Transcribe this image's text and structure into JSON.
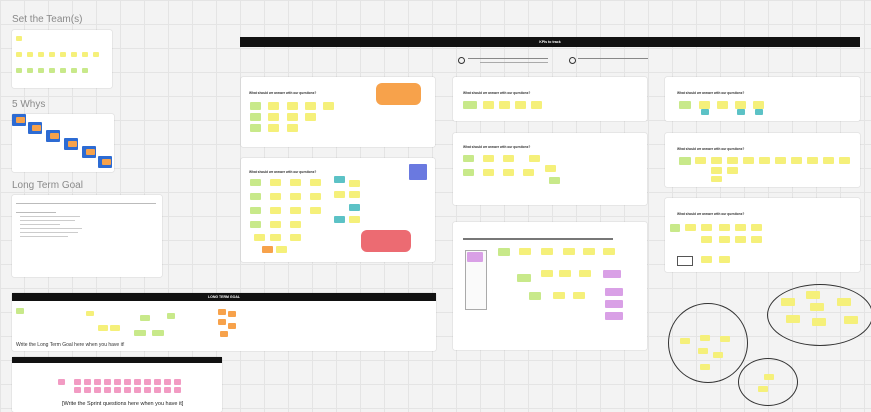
{
  "sections": {
    "team": "Set the Team(s)",
    "whys": "5 Whys",
    "goal": "Long Term Goal"
  },
  "banners": {
    "kpis": "KPIs to track",
    "long_term": "LONG TERM GOAL"
  },
  "captions": {
    "long_term_goal": "Write the Long Term Goal here when you have it!",
    "sprint_questions": "[Write the Sprint questions here when you have it]"
  },
  "question": "What should we answer with our questions?",
  "colors": {
    "yellow": "#f5f07a",
    "green": "#c8e98a",
    "orange": "#f7a24b",
    "purple": "#d9a0e6",
    "teal": "#5cc2c6",
    "pink": "#f29bc3",
    "blue": "#2d6bd3",
    "banner": "#111111"
  }
}
